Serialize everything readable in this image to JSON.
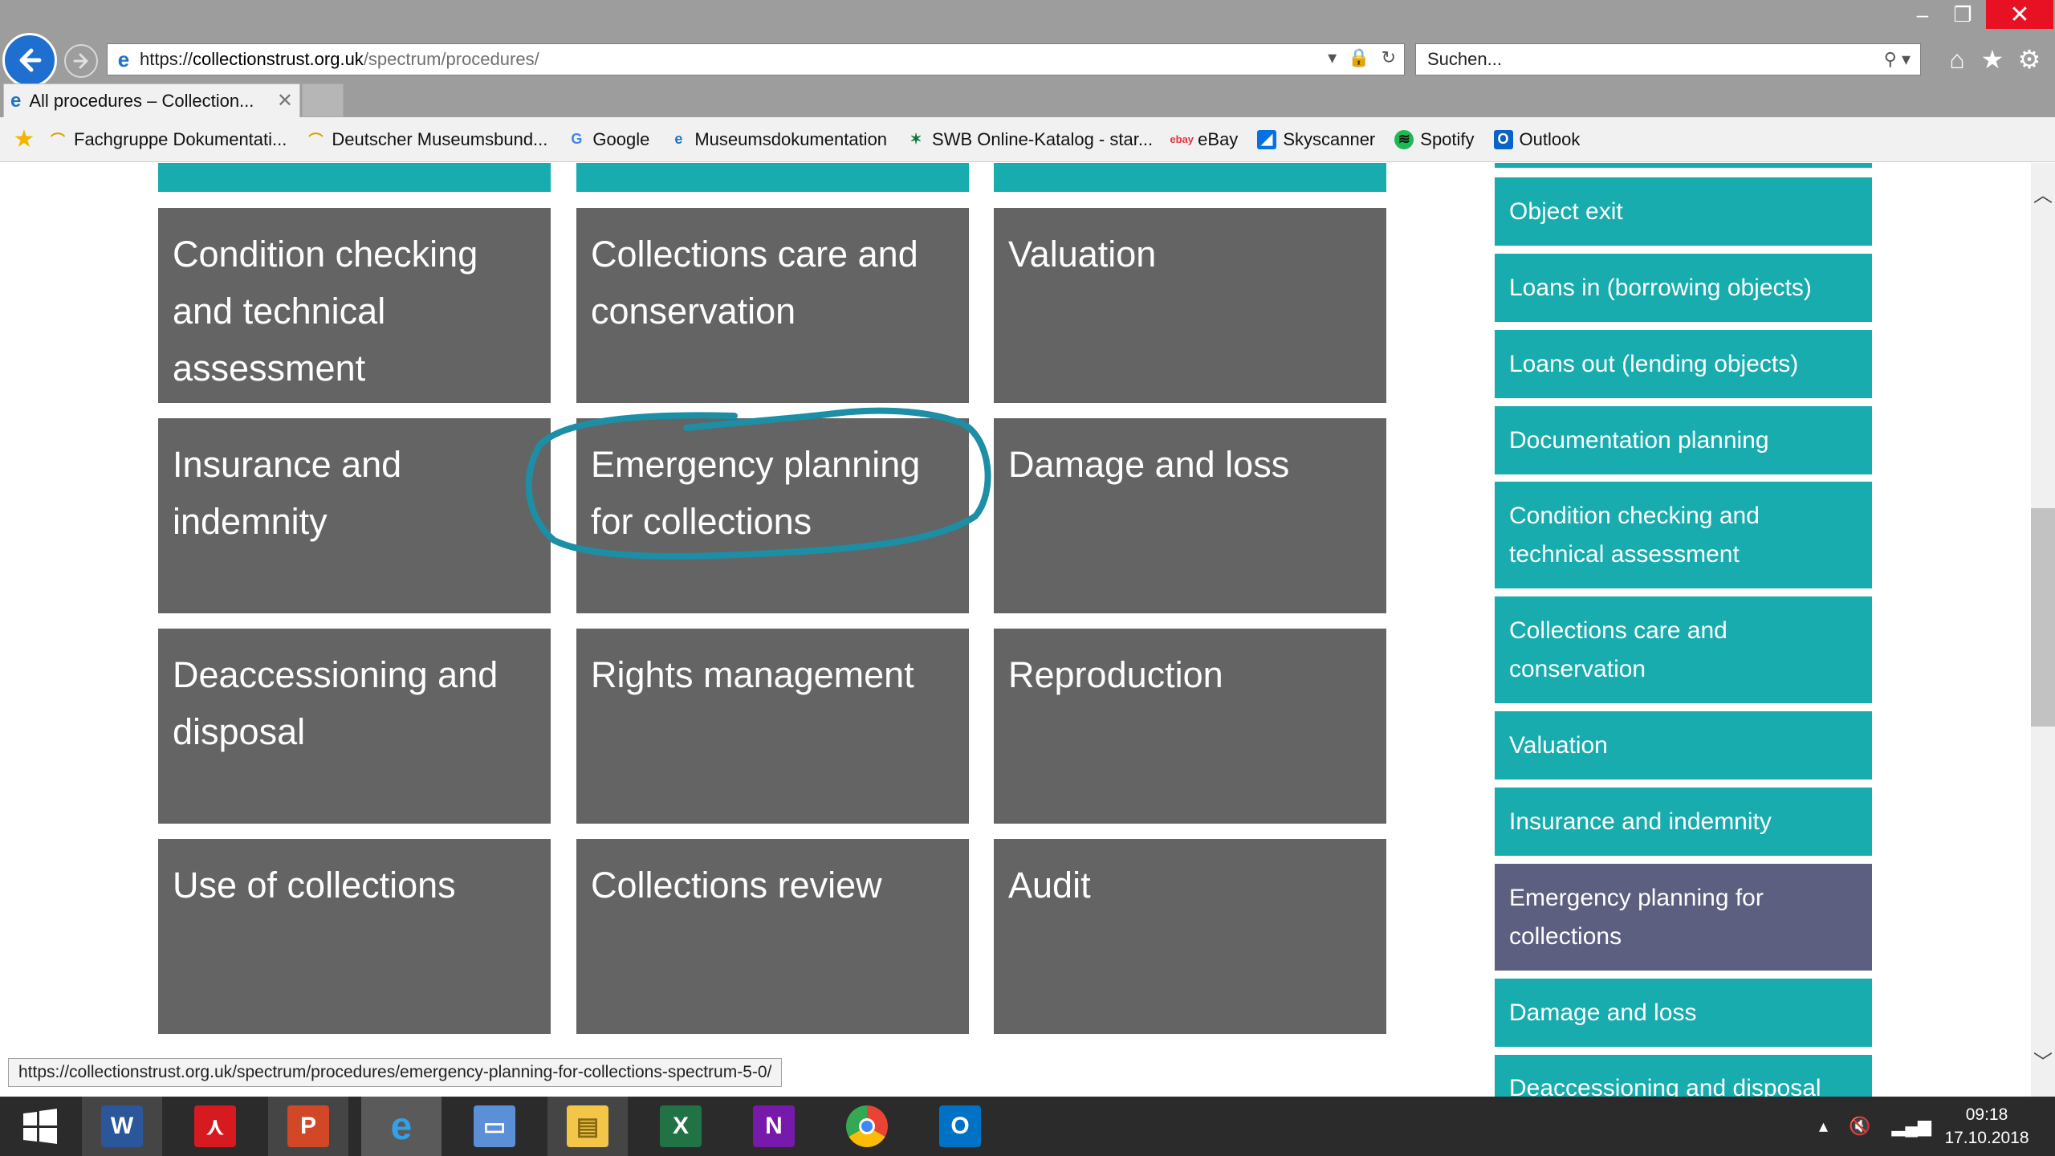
{
  "window": {
    "minimize": "–",
    "restore": "❐",
    "close": "✕"
  },
  "address": {
    "scheme": "https://",
    "host": "collectionstrust.org.uk",
    "path": "/spectrum/procedures/"
  },
  "search": {
    "placeholder": "Suchen..."
  },
  "tab": {
    "title": "All procedures – Collection...",
    "close": "✕"
  },
  "favorites": [
    "Fachgruppe Dokumentati...",
    "Deutscher Museumsbund...",
    "Google",
    "Museumsdokumentation",
    "SWB Online-Katalog - star...",
    "eBay",
    "Skyscanner",
    "Spotify",
    "Outlook"
  ],
  "tiles": [
    "Condition checking and technical assessment",
    "Collections care and conservation",
    "Valuation",
    "Insurance and indemnity",
    "Emergency planning for collections",
    "Damage and loss",
    "Deaccessioning and disposal",
    "Rights management",
    "Reproduction",
    "Use of collections",
    "Collections review",
    "Audit"
  ],
  "sidebar": [
    "Object exit",
    "Loans in (borrowing objects)",
    "Loans out (lending objects)",
    "Documentation planning",
    "Condition checking and technical assessment",
    "Collections care and conservation",
    "Valuation",
    "Insurance and indemnity",
    "Emergency planning for collections",
    "Damage and loss",
    "Deaccessioning and disposal"
  ],
  "sidebar_active": "Emergency planning for collections",
  "status_url": "https://collectionstrust.org.uk/spectrum/procedures/emergency-planning-for-collections-spectrum-5-0/",
  "taskbar": {
    "apps": [
      "windows-start",
      "word",
      "acrobat",
      "powerpoint",
      "internet-explorer",
      "remote-desktop",
      "file-explorer",
      "excel",
      "onenote",
      "chrome",
      "outlook"
    ],
    "active": "internet-explorer",
    "time": "09:18",
    "date": "17.10.2018"
  },
  "colors": {
    "teal": "#18acaf",
    "tile_gray": "#646464",
    "active_sidebar": "#5d5f80",
    "annotation": "#1c8ea5"
  }
}
